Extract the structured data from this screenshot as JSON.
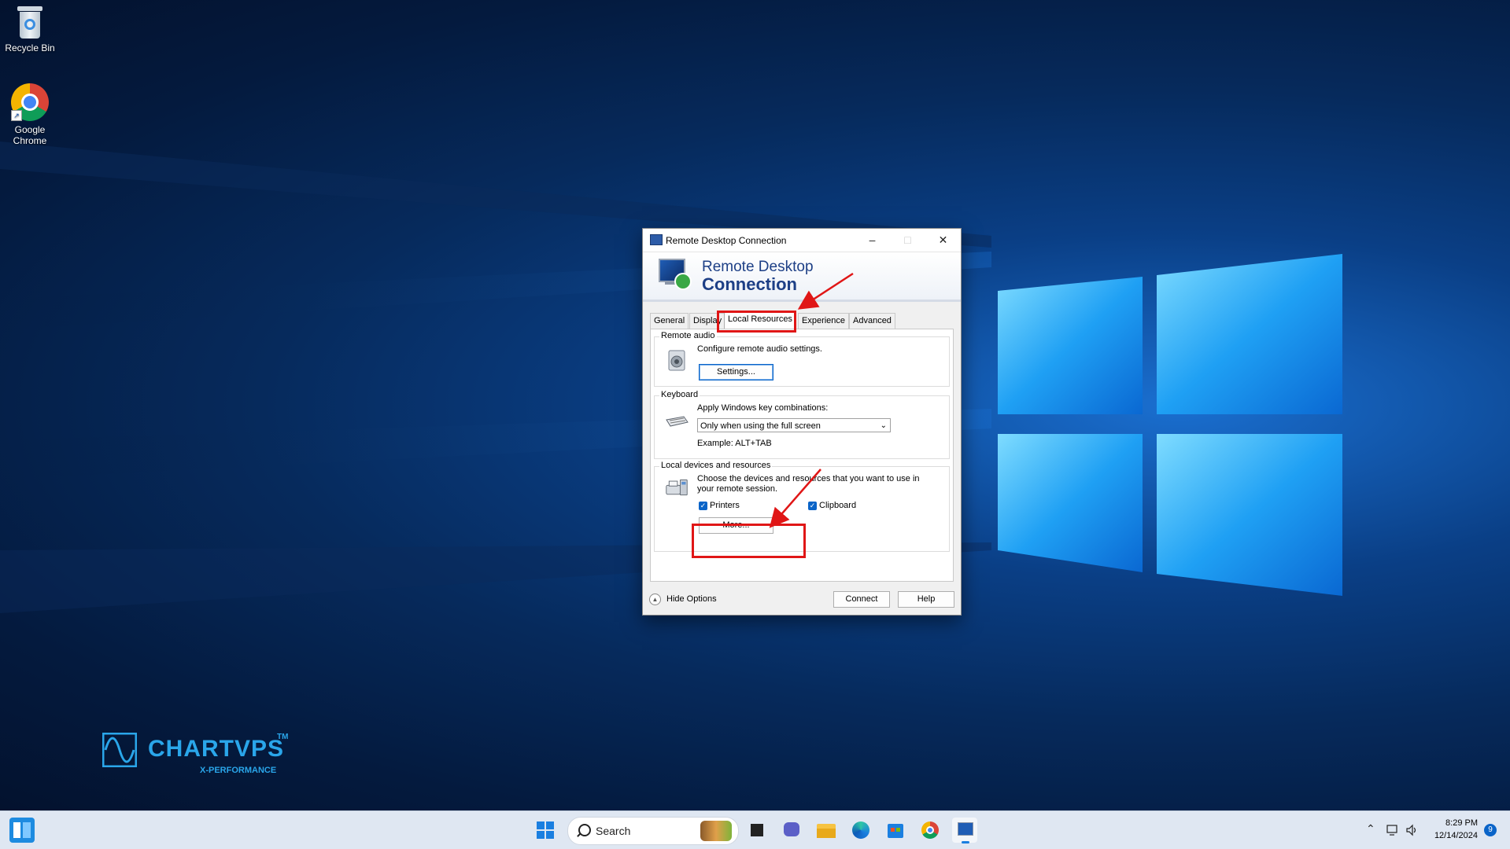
{
  "desktop": {
    "icons": [
      {
        "label": "Recycle Bin",
        "icon": "recycle-bin-icon"
      },
      {
        "label": "Google Chrome",
        "icon": "chrome-icon"
      }
    ]
  },
  "dialog": {
    "title": "Remote Desktop Connection",
    "banner_line1": "Remote Desktop",
    "banner_line2": "Connection",
    "tabs": [
      "General",
      "Display",
      "Local Resources",
      "Experience",
      "Advanced"
    ],
    "active_tab": "Local Resources",
    "remote_audio": {
      "group_label": "Remote audio",
      "description": "Configure remote audio settings.",
      "settings_button": "Settings..."
    },
    "keyboard": {
      "group_label": "Keyboard",
      "description": "Apply Windows key combinations:",
      "selected_option": "Only when using the full screen",
      "example": "Example: ALT+TAB"
    },
    "local_devices": {
      "group_label": "Local devices and resources",
      "description_line1": "Choose the devices and resources that you want to use in",
      "description_line2": "your remote session.",
      "printers_label": "Printers",
      "printers_checked": true,
      "clipboard_label": "Clipboard",
      "clipboard_checked": true,
      "more_button": "More..."
    },
    "footer": {
      "hide_options": "Hide Options",
      "connect_button": "Connect",
      "help_button": "Help"
    }
  },
  "annotation_color": "#e01616",
  "brand": {
    "name": "CHARTVPS",
    "trademark": "TM",
    "tagline": "X-PERFORMANCE"
  },
  "taskbar": {
    "search_placeholder": "Search",
    "time": "8:29 PM",
    "date": "12/14/2024",
    "notification_count": "9",
    "pinned": [
      "start-icon",
      "search-icon",
      "task-view-icon",
      "teams-chat-icon",
      "file-explorer-icon",
      "edge-icon",
      "store-icon",
      "chrome-icon",
      "remote-desktop-icon"
    ]
  }
}
